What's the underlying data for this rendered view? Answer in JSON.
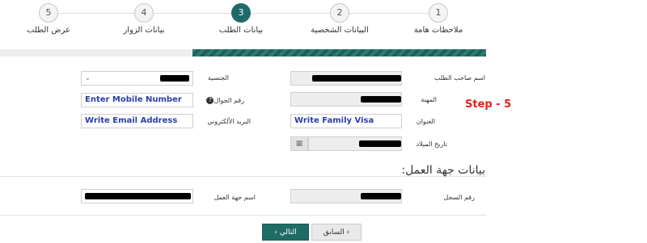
{
  "stepper": {
    "steps": [
      {
        "number": "1",
        "label": "ملاحظات هامة"
      },
      {
        "number": "2",
        "label": "البيانات الشخصية"
      },
      {
        "number": "3",
        "label": "بيانات الطلب"
      },
      {
        "number": "4",
        "label": "بيانات الزوار"
      },
      {
        "number": "5",
        "label": "عرض الطلب"
      }
    ],
    "active_step": "3"
  },
  "form": {
    "applicant_name_label": "اسم صاحب الطلب",
    "nationality_label": "الجنسية",
    "profession_label": "المهنة",
    "mobile_label": "رقم الجوال",
    "mobile_value": "Enter Mobile Number",
    "address_label": "العنوان",
    "address_value": "Write Family Visa",
    "email_label": "البريد الألكتروني",
    "email_value": "Write Email Address",
    "birthdate_label": "تاريخ الميلاد",
    "help_glyph": "?",
    "calendar_glyph": "▦",
    "dropdown_glyph": "⌄"
  },
  "annotation": {
    "step_note": "Step - 5",
    "color": "#e0231b"
  },
  "work_section": {
    "heading": "بيانات جهة العمل:",
    "registry_label": "رقم السجل",
    "employer_label": "اسم جهة العمل"
  },
  "buttons": {
    "next_label": "التالي ›",
    "prev_label": "‹ السابق"
  },
  "colors": {
    "accent": "#1f6c66",
    "entered_text": "#2b3ea8"
  }
}
